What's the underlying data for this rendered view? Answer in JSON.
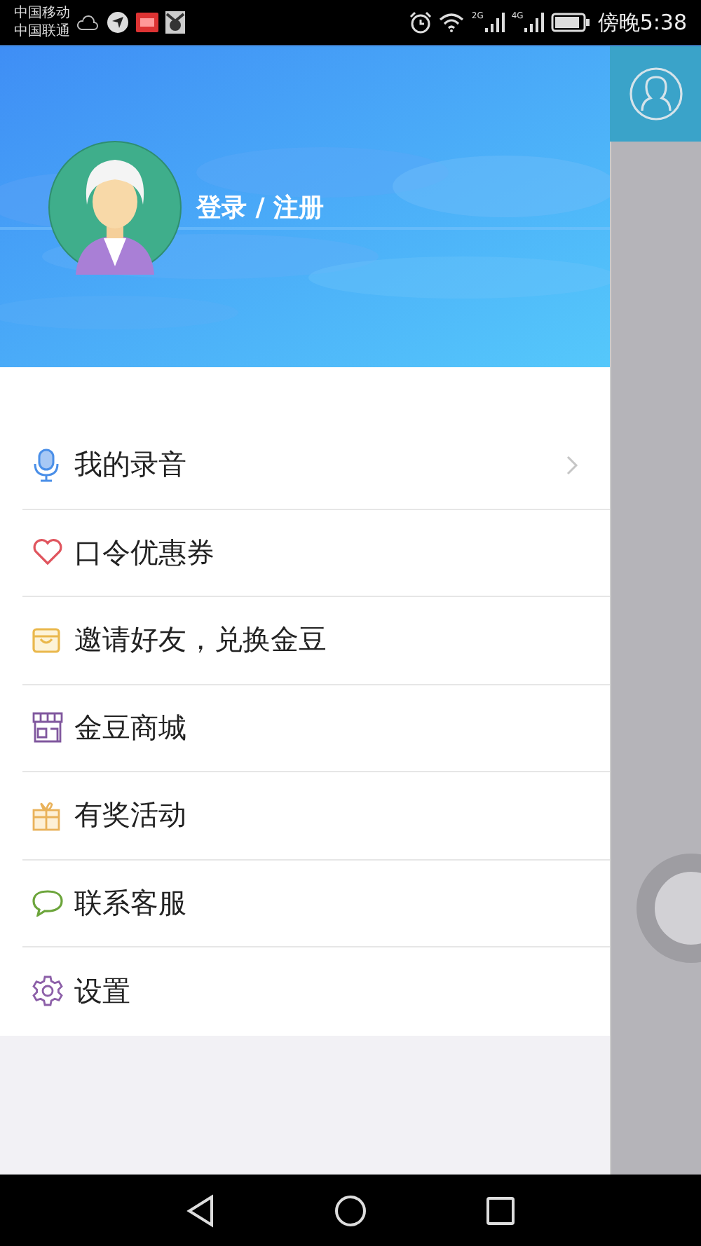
{
  "status_bar": {
    "carriers": [
      "中国移动",
      "中国联通"
    ],
    "signals": [
      "2G",
      "4G"
    ],
    "time": "傍晚5:38"
  },
  "profile": {
    "login_label": "登录 / 注册"
  },
  "menu": [
    {
      "label": "我的录音",
      "chevron": true
    },
    {
      "label": "口令优惠券",
      "chevron": false
    },
    {
      "label": "邀请好友，兑换金豆",
      "chevron": false
    },
    {
      "label": "金豆商城",
      "chevron": false
    },
    {
      "label": "有奖活动",
      "chevron": false
    },
    {
      "label": "联系客服",
      "chevron": false
    },
    {
      "label": "设置",
      "chevron": false
    }
  ]
}
